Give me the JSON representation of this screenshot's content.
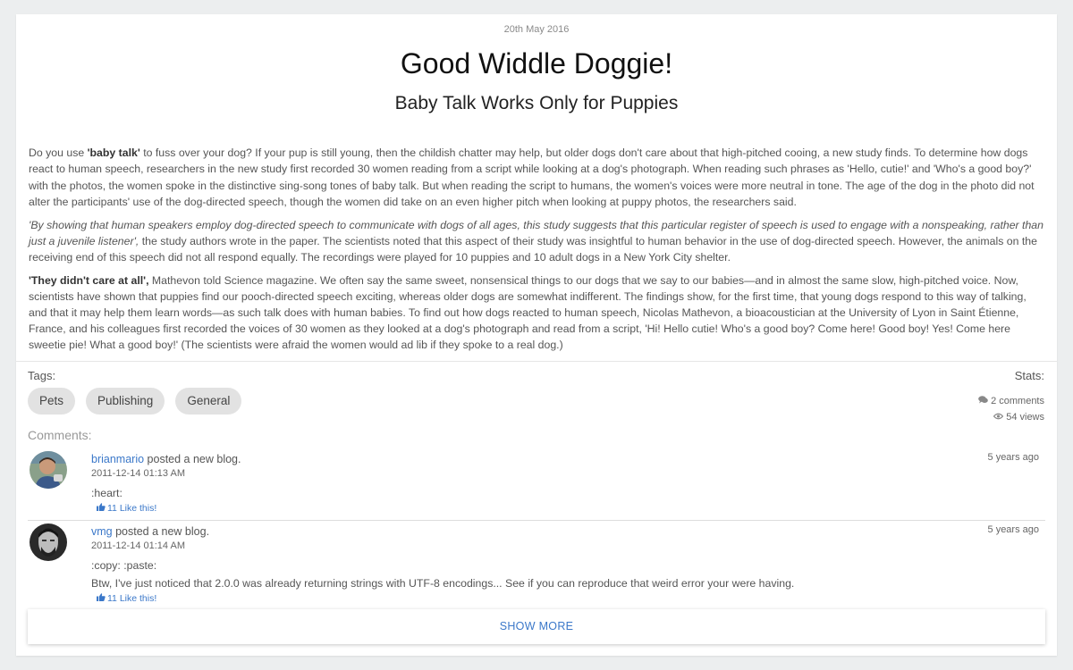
{
  "post": {
    "date": "20th May 2016",
    "title": "Good Widdle Doggie!",
    "subtitle": "Baby Talk Works Only for Puppies",
    "p1_a": "Do you use ",
    "p1_b": "'baby talk'",
    "p1_c": " to fuss over your dog? If your pup is still young, then the childish chatter may help, but older dogs don't care about that high-pitched cooing, a new study finds. To determine how dogs react to human speech, researchers in the new study first recorded 30 women reading from a script while looking at a dog's photograph. When reading such phrases as 'Hello, cutie!' and 'Who's a good boy?' with the photos, the women spoke in the distinctive sing-song tones of baby talk. But when reading the script to humans, the women's voices were more neutral in tone. The age of the dog in the photo did not alter the participants' use of the dog-directed speech, though the women did take on an even higher pitch when looking at puppy photos, the researchers said.",
    "p2_a": "'By showing that human speakers employ dog-directed speech to communicate with dogs of all ages, this study suggests that this particular register of speech is used to engage with a nonspeaking, rather than just a juvenile listener',",
    "p2_b": " the study authors wrote in the paper. The scientists noted that this aspect of their study was insightful to human behavior in the use of dog-directed speech. However, the animals on the receiving end of this speech did not all respond equally. The recordings were played for 10 puppies and 10 adult dogs in a New York City shelter.",
    "p3_a": "'They didn't care at all',",
    "p3_b": " Mathevon told Science magazine. We often say the same sweet, nonsensical things to our dogs that we say to our babies—and in almost the same slow, high-pitched voice. Now, scientists have shown that puppies find our pooch-directed speech exciting, whereas older dogs are somewhat indifferent. The findings show, for the first time, that young dogs respond to this way of talking, and that it may help them learn words—as such talk does with human babies. To find out how dogs reacted to human speech, Nicolas Mathevon, a bioacoustician at the University of Lyon in Saint Étienne, France, and his colleagues first recorded the voices of 30 women as they looked at a dog's photograph and read from a script, 'Hi! Hello cutie! Who's a good boy? Come here! Good boy! Yes! Come here sweetie pie! What a good boy!' (The scientists were afraid the women would ad lib if they spoke to a real dog.)"
  },
  "meta": {
    "tags_label": "Tags:",
    "stats_label": "Stats:",
    "tags": [
      "Pets",
      "Publishing",
      "General"
    ],
    "comments_count": "2 comments",
    "views_count": "54 views"
  },
  "comments_label": "Comments:",
  "comments": [
    {
      "user": "brianmario",
      "action": " posted a new blog.",
      "timestamp": "2011-12-14 01:13 AM",
      "text": ":heart:",
      "ago": "5 years ago",
      "likes": "11 Like this!"
    },
    {
      "user": "vmg",
      "action": " posted a new blog.",
      "timestamp": "2011-12-14 01:14 AM",
      "text": ":copy: :paste:",
      "text2": "Btw, I've just noticed that 2.0.0 was already returning strings with UTF-8 encodings... See if you can reproduce that weird error your were having.",
      "ago": "5 years ago",
      "likes": "11 Like this!"
    }
  ],
  "show_more": "SHOW MORE",
  "colors": {
    "accent": "#3b78c9",
    "tag_bg": "#e2e2e2",
    "page_bg": "#eceeef"
  },
  "icons": {
    "comments": "comment-icon",
    "views": "eye-icon",
    "like": "thumbs-up-icon"
  }
}
